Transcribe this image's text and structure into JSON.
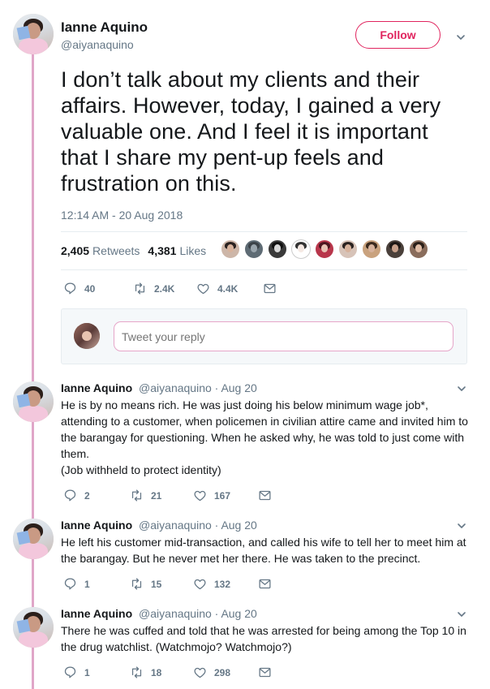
{
  "author": {
    "name": "Ianne Aquino",
    "handle": "@aiyanaquino"
  },
  "follow_label": "Follow",
  "main_tweet": {
    "text": "I don’t talk about my clients and their affairs. However, today, I gained a very valuable one. And I feel it is important that I share my pent-up feels and frustration on this.",
    "timestamp": "12:14 AM - 20 Aug 2018",
    "retweets_count": "2,405",
    "retweets_label": "Retweets",
    "likes_count": "4,381",
    "likes_label": "Likes",
    "replies": "40",
    "retweets_short": "2.4K",
    "likes_short": "4.4K"
  },
  "reply_placeholder": "Tweet your reply",
  "thread": [
    {
      "name": "Ianne Aquino",
      "handle_date": "@aiyanaquino · Aug 20",
      "lines": [
        "He is by no means rich. He was just doing his below minimum wage job*,",
        "attending to a customer, when policemen in civilian attire came and invited him to",
        "the barangay for questioning. When he asked why, he was told to just come with",
        "them.",
        "(Job withheld to protect identity)"
      ],
      "replies": "2",
      "retweets": "21",
      "likes": "167"
    },
    {
      "name": "Ianne Aquino",
      "handle_date": "@aiyanaquino · Aug 20",
      "lines": [
        "He left his customer mid-transaction, and called his wife to tell her to meet him at",
        "the barangay. But he never met her there. He was taken to the precinct."
      ],
      "replies": "1",
      "retweets": "15",
      "likes": "132"
    },
    {
      "name": "Ianne Aquino",
      "handle_date": "@aiyanaquino · Aug 20",
      "lines": [
        "There he was cuffed and told that he was arrested for being among the Top 10 in",
        "the drug watchlist. (Watchmojo? Watchmojo?)"
      ],
      "replies": "1",
      "retweets": "18",
      "likes": "298"
    }
  ],
  "icons": {
    "reply": "reply-icon",
    "retweet": "retweet-icon",
    "like": "heart-icon",
    "dm": "envelope-icon",
    "more": "chevron-down-icon"
  },
  "colors": {
    "accent": "#e0245e",
    "thread_line": "#e0a6c8",
    "muted": "#657786",
    "text": "#14171a"
  }
}
